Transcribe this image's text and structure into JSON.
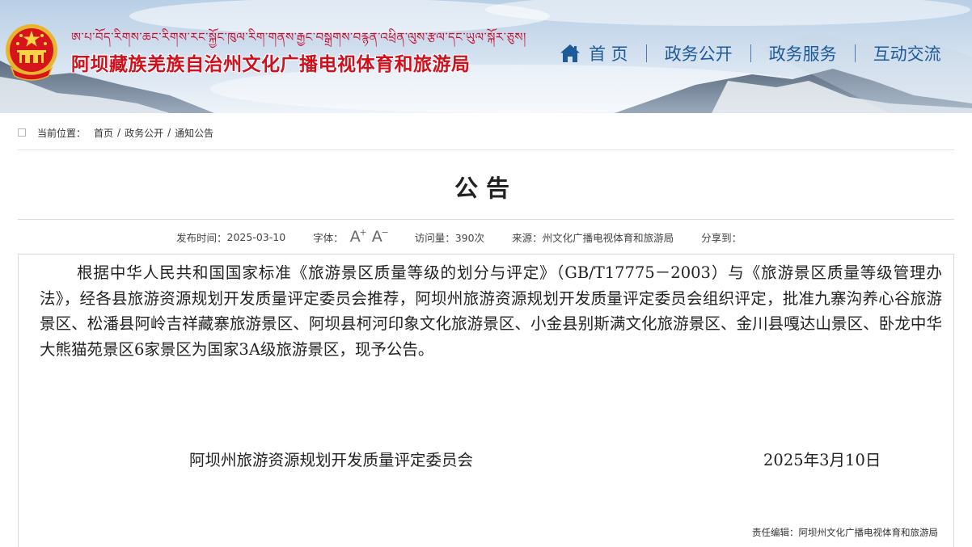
{
  "header": {
    "tibetan": "ཨ་པ་བོད་རིགས་ཆང་རིགས་རང་སྐྱོང་ཁུལ་རིག་གནས་རྒྱང་བསྒྲགས་བརྙན་འཕྲིན་ལུས་རྩལ་དང་ཡུལ་སྐོར་ཅུས།",
    "site_title": "阿坝藏族羌族自治州文化广播电视体育和旅游局"
  },
  "nav": {
    "items": [
      {
        "label": "首 页",
        "icon": "home-icon"
      },
      {
        "label": "政务公开"
      },
      {
        "label": "政务服务"
      },
      {
        "label": "互动交流"
      }
    ]
  },
  "breadcrumb": {
    "prefix": "当前位置：",
    "items": [
      "首页",
      "政务公开",
      "通知公告"
    ]
  },
  "article": {
    "title": "公告",
    "meta": {
      "publish_label": "发布时间：",
      "publish_date": "2025-03-10",
      "font_label": "字体：",
      "font_increase": "A",
      "font_increase_mark": "+",
      "font_decrease": "A",
      "font_decrease_mark": "−",
      "views_label": "访问量：",
      "views_value": "390次",
      "source_label": "来源：",
      "source_value": "州文化广播电视体育和旅游局",
      "share_label": "分享到："
    },
    "body": "根据中华人民共和国国家标准《旅游景区质量等级的划分与评定》（GB/T17775－2003）与《旅游景区质量等级管理办法》，经各县旅游资源规划开发质量评定委员会推荐，阿坝州旅游资源规划开发质量评定委员会组织评定，批准九寨沟养心谷旅游景区、松潘县阿岭吉祥藏寨旅游景区、阿坝县柯河印象文化旅游景区、小金县别斯满文化旅游景区、金川县嘎达山景区、卧龙中华大熊猫苑景区6家景区为国家3A级旅游景区，现予公告。",
    "signer": "阿坝州旅游资源规划开发质量评定委员会",
    "sign_date": "2025年3月10日",
    "editor_label": "责任编辑：",
    "editor_value": "阿坝州文化广播电视体育和旅游局"
  },
  "colors": {
    "brand_red": "#d0101c",
    "nav_blue": "#1e5a9a"
  }
}
